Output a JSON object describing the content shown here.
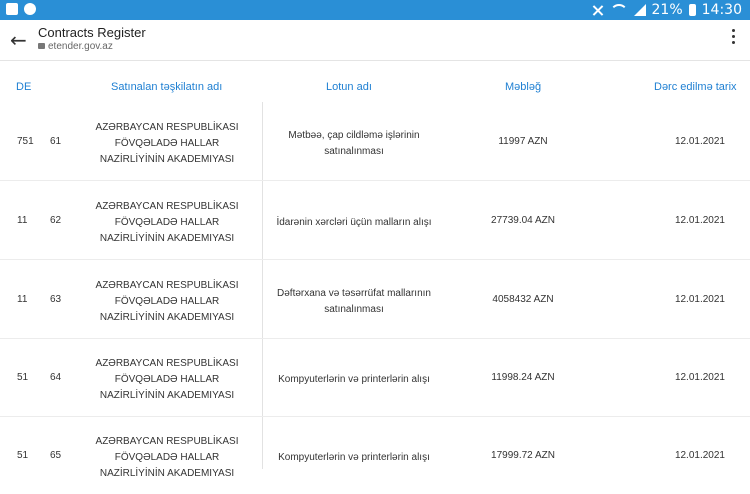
{
  "status_bar": {
    "battery": "21%",
    "time": "14:30"
  },
  "header": {
    "title": "Contracts Register",
    "url": "etender.gov.az"
  },
  "table": {
    "columns": [
      "DE",
      "Satınalan təşkilatın adı",
      "Lotun adı",
      "Məbləğ",
      "Dərc edilmə tarix"
    ],
    "rows": [
      {
        "code": "751",
        "num": "61",
        "org": "AZƏRBAYCAN RESPUBLİKASI FÖVQƏLADƏ HALLAR NAZİRLİYİNİN AKADEMIYASI",
        "lot": "Mətbəə, çap cildləmə işlərinin satınalınması",
        "amount": "11997 AZN",
        "date": "12.01.2021"
      },
      {
        "code": "11",
        "num": "62",
        "org": "AZƏRBAYCAN RESPUBLİKASI FÖVQƏLADƏ HALLAR NAZİRLİYİNİN AKADEMIYASI",
        "lot": "İdarənin xərcləri üçün malların alışı",
        "amount": "27739.04 AZN",
        "date": "12.01.2021"
      },
      {
        "code": "11",
        "num": "63",
        "org": "AZƏRBAYCAN RESPUBLİKASI FÖVQƏLADƏ HALLAR NAZİRLİYİNİN AKADEMIYASI",
        "lot": "Dəftərxana və təsərrüfat mallarının satınalınması",
        "amount": "4058432 AZN",
        "date": "12.01.2021"
      },
      {
        "code": "51",
        "num": "64",
        "org": "AZƏRBAYCAN RESPUBLİKASI FÖVQƏLADƏ HALLAR NAZİRLİYİNİN AKADEMIYASI",
        "lot": "Kompyuterlərin və printerlərin alışı",
        "amount": "11998.24 AZN",
        "date": "12.01.2021"
      },
      {
        "code": "51",
        "num": "65",
        "org": "AZƏRBAYCAN RESPUBLİKASI FÖVQƏLADƏ HALLAR NAZİRLİYİNİN AKADEMIYASI",
        "lot": "Kompyuterlərin və printerlərin alışı",
        "amount": "17999.72 AZN",
        "date": "12.01.2021"
      }
    ]
  }
}
